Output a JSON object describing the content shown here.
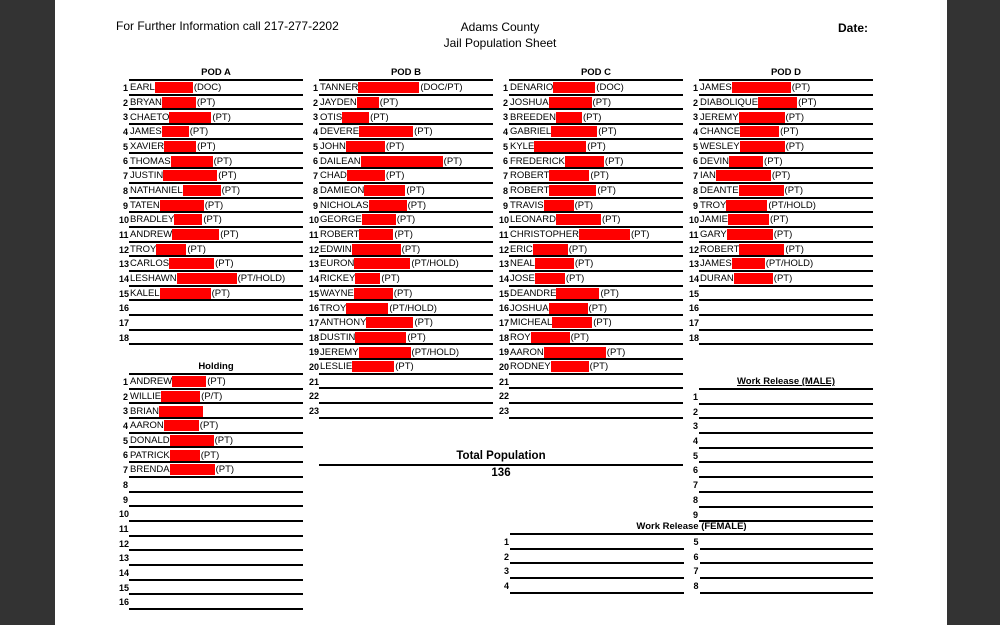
{
  "header": {
    "info": "For Further Information call 217-277-2202",
    "county": "Adams County",
    "sheet_title": "Jail Population Sheet",
    "date_label": "Date:"
  },
  "colors": {
    "redaction": "#ff0000",
    "background": "#333333",
    "page": "#ffffff"
  },
  "pods": [
    {
      "title": "POD A",
      "rows": [
        {
          "n": "1",
          "name": "EARL",
          "status": "(DOC)",
          "r": 38
        },
        {
          "n": "2",
          "name": "BRYAN",
          "status": "(PT)",
          "r": 34
        },
        {
          "n": "3",
          "name": "CHAETO",
          "status": "(PT)",
          "r": 42
        },
        {
          "n": "4",
          "name": "JAMES",
          "status": "(PT)",
          "r": 27
        },
        {
          "n": "5",
          "name": "XAVIER",
          "status": "(PT)",
          "r": 32
        },
        {
          "n": "6",
          "name": "THOMAS",
          "status": "(PT)",
          "r": 42
        },
        {
          "n": "7",
          "name": "JUSTIN",
          "status": "(PT)",
          "r": 54
        },
        {
          "n": "8",
          "name": "NATHANIEL",
          "status": "(PT)",
          "r": 38
        },
        {
          "n": "9",
          "name": "TATEN",
          "status": "(PT)",
          "r": 44
        },
        {
          "n": "10",
          "name": "BRADLEY",
          "status": "(PT)",
          "r": 28
        },
        {
          "n": "11",
          "name": "ANDREW",
          "status": "(PT)",
          "r": 47
        },
        {
          "n": "12",
          "name": "TROY",
          "status": "(PT)",
          "r": 30
        },
        {
          "n": "13",
          "name": "CARLOS",
          "status": "(PT)",
          "r": 45
        },
        {
          "n": "14",
          "name": "LESHAWN",
          "status": "(PT/HOLD)",
          "r": 60
        },
        {
          "n": "15",
          "name": "KALEL",
          "status": "(PT)",
          "r": 51
        },
        {
          "n": "16",
          "name": "",
          "status": "",
          "r": 0
        },
        {
          "n": "17",
          "name": "",
          "status": "",
          "r": 0
        },
        {
          "n": "18",
          "name": "",
          "status": "",
          "r": 0
        }
      ]
    },
    {
      "title": "POD B",
      "rows": [
        {
          "n": "1",
          "name": "TANNER",
          "status": "(DOC/PT)",
          "r": 61
        },
        {
          "n": "2",
          "name": "JAYDEN",
          "status": "(PT)",
          "r": 22
        },
        {
          "n": "3",
          "name": "OTIS",
          "status": "(PT)",
          "r": 27
        },
        {
          "n": "4",
          "name": "DEVERE",
          "status": "(PT)",
          "r": 54
        },
        {
          "n": "5",
          "name": "JOHN",
          "status": "(PT)",
          "r": 39
        },
        {
          "n": "6",
          "name": "DAILEAN",
          "status": "(PT)",
          "r": 82
        },
        {
          "n": "7",
          "name": "CHAD",
          "status": "(PT)",
          "r": 38
        },
        {
          "n": "8",
          "name": "DAMIEON",
          "status": "(PT)",
          "r": 41
        },
        {
          "n": "9",
          "name": "NICHOLAS",
          "status": "(PT)",
          "r": 38
        },
        {
          "n": "10",
          "name": "GEORGE",
          "status": "(PT)",
          "r": 34
        },
        {
          "n": "11",
          "name": "ROBERT",
          "status": "(PT)",
          "r": 34
        },
        {
          "n": "12",
          "name": "EDWIN",
          "status": "(PT)",
          "r": 49
        },
        {
          "n": "13",
          "name": "EURON",
          "status": "(PT/HOLD)",
          "r": 56
        },
        {
          "n": "14",
          "name": "RICKEY",
          "status": "(PT)",
          "r": 25
        },
        {
          "n": "15",
          "name": "WAYNE",
          "status": "(PT)",
          "r": 39
        },
        {
          "n": "16",
          "name": "TROY",
          "status": "(PT/HOLD)",
          "r": 42
        },
        {
          "n": "17",
          "name": "ANTHONY",
          "status": "(PT)",
          "r": 47
        },
        {
          "n": "18",
          "name": "DUSTIN",
          "status": "(PT)",
          "r": 51
        },
        {
          "n": "19",
          "name": "JEREMY",
          "status": "(PT/HOLD)",
          "r": 52
        },
        {
          "n": "20",
          "name": "LESLIE",
          "status": "(PT)",
          "r": 42
        },
        {
          "n": "21",
          "name": "",
          "status": "",
          "r": 0
        },
        {
          "n": "22",
          "name": "",
          "status": "",
          "r": 0
        },
        {
          "n": "23",
          "name": "",
          "status": "",
          "r": 0
        }
      ]
    },
    {
      "title": "POD C",
      "rows": [
        {
          "n": "1",
          "name": "DENARIO",
          "status": "(DOC)",
          "r": 42
        },
        {
          "n": "2",
          "name": "JOSHUA",
          "status": "(PT)",
          "r": 43
        },
        {
          "n": "3",
          "name": "BREEDEN",
          "status": "(PT)",
          "r": 26
        },
        {
          "n": "4",
          "name": "GABRIEL",
          "status": "(PT)",
          "r": 46
        },
        {
          "n": "5",
          "name": "KYLE",
          "status": "(PT)",
          "r": 52
        },
        {
          "n": "6",
          "name": "FREDERICK",
          "status": "(PT)",
          "r": 39
        },
        {
          "n": "7",
          "name": "ROBERT",
          "status": "(PT)",
          "r": 40
        },
        {
          "n": "8",
          "name": "ROBERT",
          "status": "(PT)",
          "r": 47
        },
        {
          "n": "9",
          "name": "TRAVIS",
          "status": "(PT)",
          "r": 30
        },
        {
          "n": "10",
          "name": "LEONARD",
          "status": "(PT)",
          "r": 45
        },
        {
          "n": "11",
          "name": "CHRISTOPHER",
          "status": "(PT)",
          "r": 51
        },
        {
          "n": "12",
          "name": "ERIC",
          "status": "(PT)",
          "r": 35
        },
        {
          "n": "13",
          "name": "NEAL",
          "status": "(PT)",
          "r": 39
        },
        {
          "n": "14",
          "name": "JOSE",
          "status": "(PT)",
          "r": 30
        },
        {
          "n": "15",
          "name": "DEANDRE",
          "status": "(PT)",
          "r": 43
        },
        {
          "n": "16",
          "name": "JOSHUA",
          "status": "(PT)",
          "r": 39
        },
        {
          "n": "17",
          "name": "MICHEAL",
          "status": "(PT)",
          "r": 40
        },
        {
          "n": "18",
          "name": "ROY",
          "status": "(PT)",
          "r": 39
        },
        {
          "n": "19",
          "name": "AARON",
          "status": "(PT)",
          "r": 62
        },
        {
          "n": "20",
          "name": "RODNEY",
          "status": "(PT)",
          "r": 38
        },
        {
          "n": "21",
          "name": "",
          "status": "",
          "r": 0
        },
        {
          "n": "22",
          "name": "",
          "status": "",
          "r": 0
        },
        {
          "n": "23",
          "name": "",
          "status": "",
          "r": 0
        }
      ]
    },
    {
      "title": "POD D",
      "rows": [
        {
          "n": "1",
          "name": "JAMES",
          "status": "(PT)",
          "r": 59
        },
        {
          "n": "2",
          "name": "DIABOLIQUE",
          "status": "(PT)",
          "r": 39
        },
        {
          "n": "3",
          "name": "JEREMY",
          "status": "(PT)",
          "r": 46
        },
        {
          "n": "4",
          "name": "CHANCE",
          "status": "(PT)",
          "r": 39
        },
        {
          "n": "5",
          "name": "WESLEY",
          "status": "(PT)",
          "r": 45
        },
        {
          "n": "6",
          "name": "DEVIN",
          "status": "(PT)",
          "r": 34
        },
        {
          "n": "7",
          "name": "IAN",
          "status": "(PT)",
          "r": 55
        },
        {
          "n": "8",
          "name": "DEANTE",
          "status": "(PT)",
          "r": 45
        },
        {
          "n": "9",
          "name": "TROY",
          "status": "(PT/HOLD)",
          "r": 41
        },
        {
          "n": "10",
          "name": "JAMIE",
          "status": "(PT)",
          "r": 41
        },
        {
          "n": "11",
          "name": "GARY",
          "status": "(PT)",
          "r": 46
        },
        {
          "n": "12",
          "name": "ROBERT",
          "status": "(PT)",
          "r": 45
        },
        {
          "n": "13",
          "name": "JAMES",
          "status": "(PT/HOLD)",
          "r": 33
        },
        {
          "n": "14",
          "name": "DURAN",
          "status": "(PT)",
          "r": 39
        },
        {
          "n": "15",
          "name": "",
          "status": "",
          "r": 0
        },
        {
          "n": "16",
          "name": "",
          "status": "",
          "r": 0
        },
        {
          "n": "17",
          "name": "",
          "status": "",
          "r": 0
        },
        {
          "n": "18",
          "name": "",
          "status": "",
          "r": 0
        }
      ]
    }
  ],
  "holding": {
    "title": "Holding",
    "rows": [
      {
        "n": "1",
        "name": "ANDREW",
        "status": "(PT)",
        "r": 34
      },
      {
        "n": "2",
        "name": "WILLIE",
        "status": "(P/T)",
        "r": 39
      },
      {
        "n": "3",
        "name": "BRIAN",
        "status": "",
        "r": 44
      },
      {
        "n": "4",
        "name": "AARON",
        "status": "(PT)",
        "r": 35
      },
      {
        "n": "5",
        "name": "DONALD",
        "status": "(PT)",
        "r": 44
      },
      {
        "n": "6",
        "name": "PATRICK",
        "status": "(PT)",
        "r": 30
      },
      {
        "n": "7",
        "name": "BRENDA",
        "status": "(PT)",
        "r": 45
      },
      {
        "n": "8",
        "name": "",
        "status": "",
        "r": 0
      },
      {
        "n": "9",
        "name": "",
        "status": "",
        "r": 0
      },
      {
        "n": "10",
        "name": "",
        "status": "",
        "r": 0
      },
      {
        "n": "11",
        "name": "",
        "status": "",
        "r": 0
      },
      {
        "n": "12",
        "name": "",
        "status": "",
        "r": 0
      },
      {
        "n": "13",
        "name": "",
        "status": "",
        "r": 0
      },
      {
        "n": "14",
        "name": "",
        "status": "",
        "r": 0
      },
      {
        "n": "15",
        "name": "",
        "status": "",
        "r": 0
      },
      {
        "n": "16",
        "name": "",
        "status": "",
        "r": 0
      }
    ]
  },
  "total": {
    "label": "Total Population",
    "value": "136"
  },
  "work_release_male": {
    "title": "Work Release (MALE)",
    "rows": [
      {
        "n": "1",
        "name": "",
        "status": "",
        "r": 0
      },
      {
        "n": "2",
        "name": "",
        "status": "",
        "r": 0
      },
      {
        "n": "3",
        "name": "",
        "status": "",
        "r": 0
      },
      {
        "n": "4",
        "name": "",
        "status": "",
        "r": 0
      },
      {
        "n": "5",
        "name": "",
        "status": "",
        "r": 0
      },
      {
        "n": "6",
        "name": "",
        "status": "",
        "r": 0
      },
      {
        "n": "7",
        "name": "",
        "status": "",
        "r": 0
      },
      {
        "n": "8",
        "name": "",
        "status": "",
        "r": 0
      },
      {
        "n": "9",
        "name": "",
        "status": "",
        "r": 0
      }
    ]
  },
  "work_release_female": {
    "title": "Work Release (FEMALE)",
    "left_rows": [
      {
        "n": "1",
        "name": "",
        "status": "",
        "r": 0
      },
      {
        "n": "2",
        "name": "",
        "status": "",
        "r": 0
      },
      {
        "n": "3",
        "name": "",
        "status": "",
        "r": 0
      },
      {
        "n": "4",
        "name": "",
        "status": "",
        "r": 0
      }
    ],
    "right_rows": [
      {
        "n": "5",
        "name": "",
        "status": "",
        "r": 0
      },
      {
        "n": "6",
        "name": "",
        "status": "",
        "r": 0
      },
      {
        "n": "7",
        "name": "",
        "status": "",
        "r": 0
      },
      {
        "n": "8",
        "name": "",
        "status": "",
        "r": 0
      }
    ]
  }
}
